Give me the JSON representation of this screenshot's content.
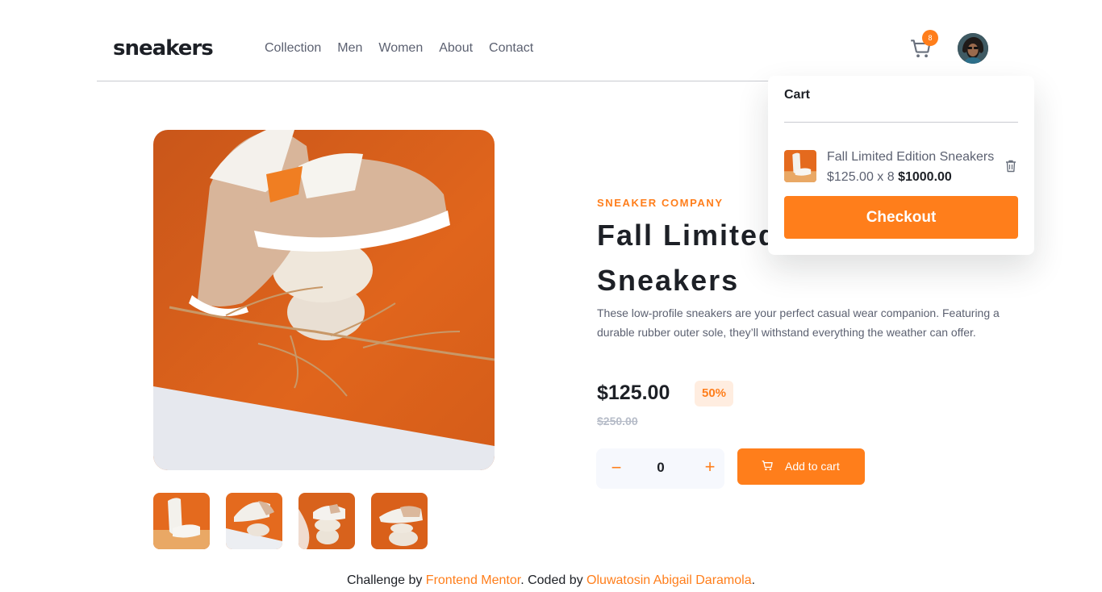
{
  "brand": {
    "logo": "sneakers"
  },
  "nav": [
    "Collection",
    "Men",
    "Women",
    "About",
    "Contact"
  ],
  "header": {
    "cart_count": "8",
    "cart_icon": "cart-icon",
    "avatar": "user-avatar"
  },
  "product": {
    "company": "SNEAKER COMPANY",
    "title_line1": "Fall Limited",
    "title_line2": "Sneakers",
    "description": "These low-profile sneakers are your perfect casual wear companion. Featuring a durable rubber outer sole, they’ll withstand everything the weather can offer.",
    "price": "$125.00",
    "discount": "50%",
    "old_price": "$250.00",
    "quantity": "0",
    "minus_label": "−",
    "plus_label": "+",
    "add_to_cart": "Add to cart"
  },
  "cart": {
    "title": "Cart",
    "item_name": "Fall Limited Edition Sneakers",
    "item_price": "$125.00 x 8",
    "item_total": "$1000.00",
    "checkout": "Checkout"
  },
  "footer": {
    "prefix": "Challenge by",
    "mentor_link": "Frontend Mentor",
    "middle": ". Coded by",
    "author_link": "Oluwatosin Abigail Daramola",
    "suffix": "."
  },
  "colors": {
    "accent": "#ff7e1b",
    "accent_light": "#ffede0",
    "text_dark": "#1d2026",
    "text_gray": "#5c6171",
    "strike_gray": "#b6bcc8",
    "product_bg_orange": "#d9621c"
  }
}
